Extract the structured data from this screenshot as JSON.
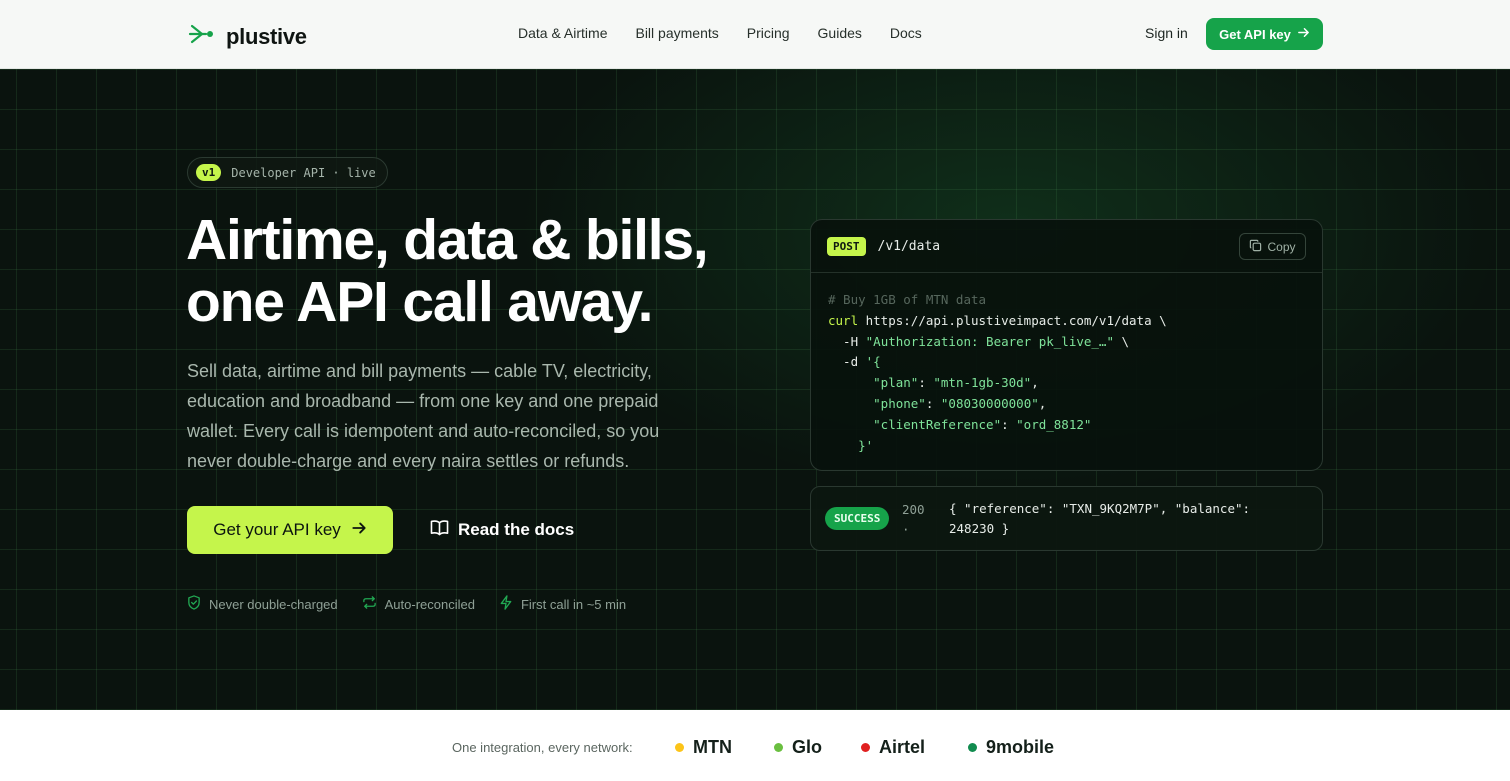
{
  "header": {
    "logo_text": "plustive",
    "nav": [
      "Data & Airtime",
      "Bill payments",
      "Pricing",
      "Guides",
      "Docs"
    ],
    "signin": "Sign in",
    "cta": "Get API key"
  },
  "hero": {
    "pill_badge": "v1",
    "pill_text": "Developer API · live",
    "headline_line1": "Airtime, data & bills,",
    "headline_line2": "one API call away.",
    "lead": "Sell data, airtime and bill payments — cable TV, electricity, education and broadband — from one key and one prepaid wallet. Every call is idempotent and auto-reconciled, so you never double-charge and every naira settles or refunds.",
    "cta_primary": "Get your API key",
    "cta_secondary": "Read the docs",
    "features": [
      "Never double-charged",
      "Auto-reconciled",
      "First call in ~5 min"
    ]
  },
  "code": {
    "method": "POST",
    "path": "/v1/data",
    "copy_label": "Copy",
    "comment": "# Buy 1GB of MTN data",
    "cmd": "curl",
    "url": " https://api.plustiveimpact.com/v1/data \\",
    "header_flag": "  -H ",
    "header_value": "\"Authorization: Bearer pk_live_…\"",
    "header_tail": " \\",
    "data_flag": "  -d ",
    "data_open": "'{",
    "plan_key": "      \"plan\"",
    "plan_value": "\"mtn-1gb-30d\"",
    "phone_key": "      \"phone\"",
    "phone_value": "\"08030000000\"",
    "ref_key": "      \"clientReference\"",
    "ref_value": "\"ord_8812\"",
    "data_close": "    }'"
  },
  "response": {
    "badge": "SUCCESS",
    "status": "200 ·",
    "body": "{ \"reference\": \"TXN_9KQ2M7P\", \"balance\": 248230 }"
  },
  "networks": {
    "label": "One integration, every network:",
    "items": [
      {
        "name": "MTN",
        "color": "#fcc419"
      },
      {
        "name": "Glo",
        "color": "#6abf40"
      },
      {
        "name": "Airtel",
        "color": "#e02020"
      },
      {
        "name": "9mobile",
        "color": "#118c4f"
      }
    ]
  },
  "colors": {
    "accent": "#c5f54b",
    "brand": "#16a34a",
    "hero_bg": "#0a130e"
  }
}
